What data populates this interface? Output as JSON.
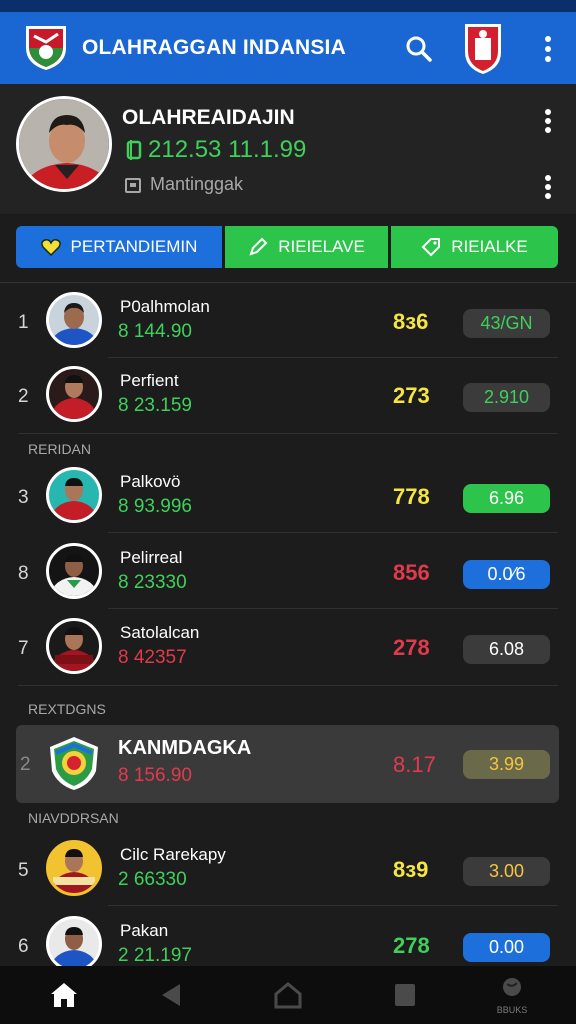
{
  "app": {
    "title": "OLAHRAGGAN INDANSIA"
  },
  "colors": {
    "green": "#3ed05a",
    "yellow": "#f5e642",
    "red": "#e03a4c",
    "blue": "#1d6fdc",
    "appbar": "#1a66d2"
  },
  "profile": {
    "name": "OLAHREAIDAJIN",
    "score": "212.53 11.1.99",
    "department": "Mantinggak"
  },
  "tabs": [
    {
      "label": "PERTANDIEMIN",
      "icon": "heart-icon"
    },
    {
      "label": "RIEIELAVE",
      "icon": "pencil-icon"
    },
    {
      "label": "RIEIALKE",
      "icon": "tag-icon"
    }
  ],
  "sections": {
    "s1": "RERIDAN",
    "s2": "REXTDGNS",
    "s3": "NIAVDDRSAN"
  },
  "rows": [
    {
      "rank": "1",
      "name": "P0alhmolan",
      "sub": "8 144.90",
      "points": "8ɜ6",
      "pill": "43/GN"
    },
    {
      "rank": "2",
      "name": "Perfient",
      "sub": "8 23.159",
      "points": "273",
      "pill": "2.910"
    },
    {
      "rank": "3",
      "name": "Palkovö",
      "sub": "8 93.996",
      "points": "778",
      "pill": "6.96"
    },
    {
      "rank": "8",
      "name": "Pelirreal",
      "sub": "8 23330",
      "points": "856",
      "pill": "0.0⁄6"
    },
    {
      "rank": "7",
      "name": "Satolalcan",
      "sub": "8 42357",
      "points": "278",
      "pill": "6.08"
    },
    {
      "rank": "2",
      "name": "KANMDAGKA",
      "sub": "8 156.90",
      "points": "8.17",
      "pill": "3.99"
    },
    {
      "rank": "5",
      "name": "Cilc Rarekapy",
      "sub": "2 66330",
      "points": "8ɜ9",
      "pill": "3.00"
    },
    {
      "rank": "6",
      "name": "Pakan",
      "sub": "2 21.197",
      "points": "278",
      "pill": "0.00"
    }
  ],
  "nav": {
    "extra_label": "BBUKS"
  }
}
